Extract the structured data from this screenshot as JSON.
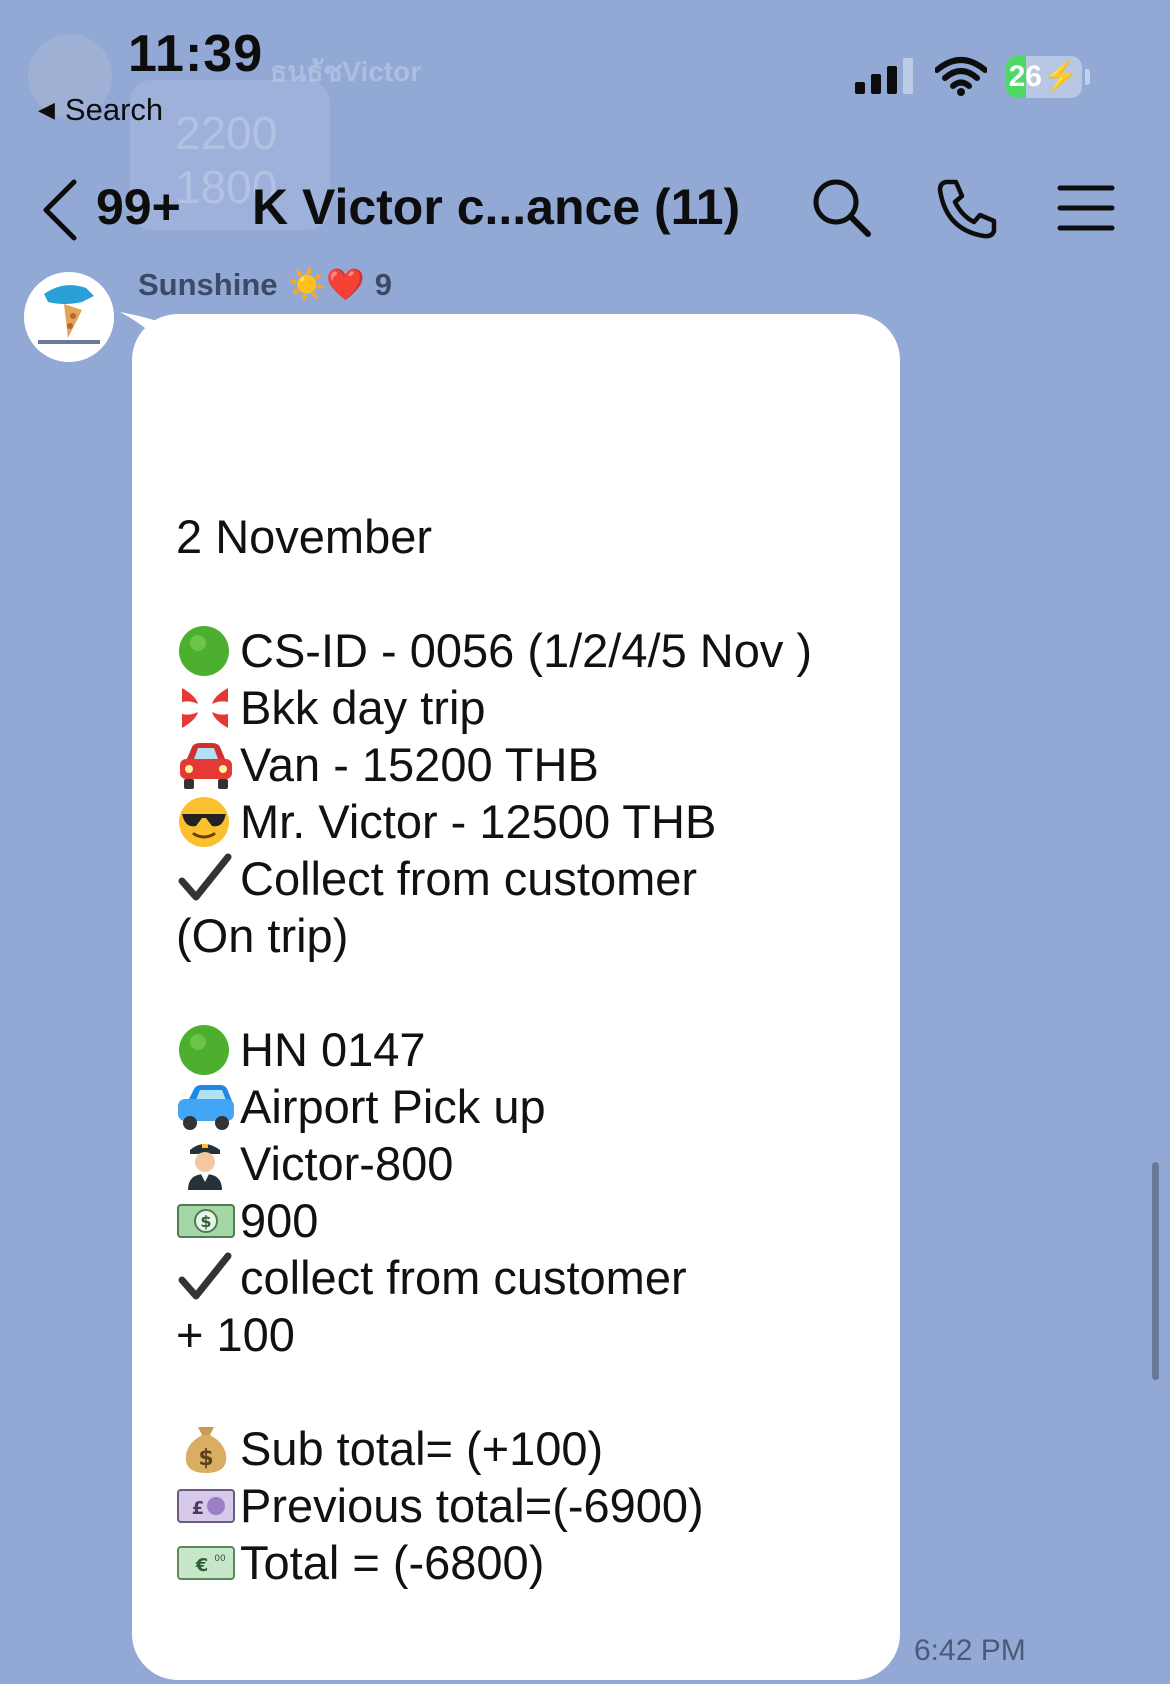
{
  "background_notification": {
    "sender_partial": "ธนธัชVictor",
    "lines": [
      "2200",
      "1800"
    ]
  },
  "status_bar": {
    "time": "11:39",
    "back_label": "Search",
    "battery_level": "26",
    "battery_fraction": 0.26,
    "signal_bars": 3,
    "colors": {
      "battery": "#4cd964",
      "background": "#92a9d6"
    }
  },
  "header": {
    "unread_count": "99+",
    "title": "K Victor c...ance  (11)",
    "icons": [
      "chevron-left-icon",
      "search-icon",
      "phone-icon",
      "menu-icon"
    ]
  },
  "message": {
    "sender_name": "Sunshine",
    "sender_emoji": "☀️❤️",
    "sender_suffix": "9",
    "timestamp": "6:42 PM",
    "date": "2 November",
    "trip1": {
      "line1": "CS-ID - 0056 (1/2/4/5 Nov )",
      "line2": "Bkk day trip",
      "line3": "Van - 15200 THB",
      "line4": "Mr. Victor - 12500 THB",
      "line5": "Collect from customer",
      "line6": "(On trip)",
      "icons": [
        "green-circle-icon",
        "anger-symbol-icon",
        "red-car-icon",
        "sunglasses-face-icon",
        "checkmark-icon"
      ]
    },
    "trip2": {
      "line1": "HN 0147",
      "line2": "Airport Pick up",
      "line3": "Victor-800",
      "line4": "900",
      "line5": "collect from customer",
      "line6": "+ 100",
      "icons": [
        "green-circle-icon",
        "blue-car-icon",
        "pilot-icon",
        "dollar-banknote-icon",
        "checkmark-icon"
      ]
    },
    "totals": {
      "sub_total": "Sub total= (+100)",
      "previous_total": " Previous total=(-6900)",
      "total": " Total = (-6800)",
      "icons": [
        "money-bag-icon",
        "pound-banknote-icon",
        "euro-banknote-icon"
      ]
    }
  }
}
